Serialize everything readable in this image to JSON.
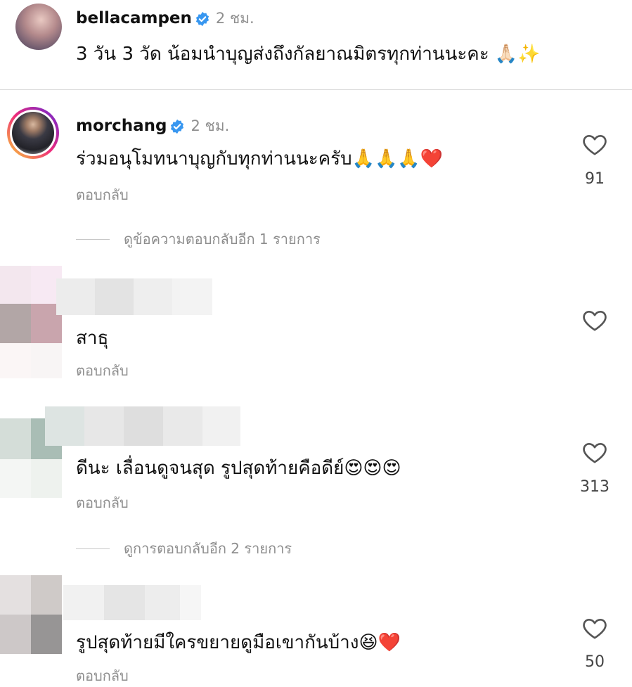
{
  "post": {
    "username": "bellacampen",
    "time": "2 ชม.",
    "caption": "3 วัน 3 วัด น้อมนำบุญส่งถึงกัลยาณมิตรทุกท่านนะคะ 🙏🏻✨"
  },
  "comments": [
    {
      "username": "morchang",
      "time": "2 ชม.",
      "text": "ร่วมอนุโมทนาบุญกับทุกท่านนะครับ🙏🙏🙏❤️",
      "reply_label": "ตอบกลับ",
      "likes": "91",
      "view_replies": "ดูข้อความตอบกลับอีก 1 รายการ"
    },
    {
      "text": "สาธุ",
      "reply_label": "ตอบกลับ"
    },
    {
      "text": "ดีนะ เลื่อนดูจนสุด รูปสุดท้ายคือดีย์😍😍😍",
      "reply_label": "ตอบกลับ",
      "likes": "313",
      "view_replies": "ดูการตอบกลับอีก 2 รายการ"
    },
    {
      "text": "รูปสุดท้ายมีใครขยายดูมือเขากันบ้าง😆❤️",
      "reply_label": "ตอบกลับ",
      "likes": "50"
    }
  ],
  "icons": {
    "verified": "verified-badge-icon",
    "heart": "heart-outline-icon"
  },
  "colors": {
    "verified_blue": "#3897f0",
    "secondary_text": "#8e8e8e"
  }
}
